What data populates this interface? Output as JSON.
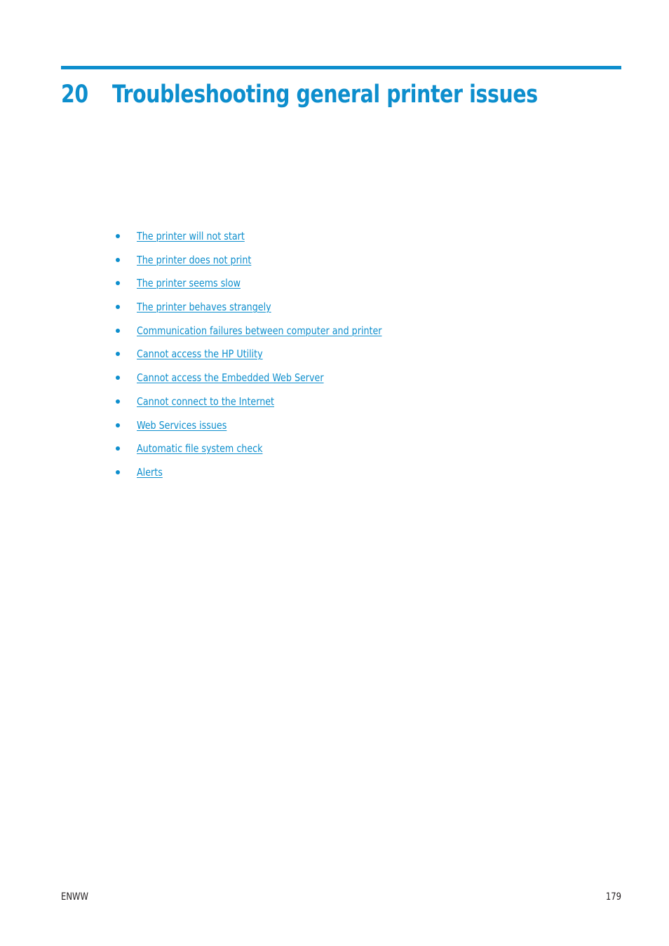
{
  "document": {
    "chapter_number": "20",
    "chapter_title": "Troubleshooting general printer issues",
    "rule_color": "#0d8ecd",
    "accent_color": "#0d8ecd",
    "text_color": "#231f20"
  },
  "toc": {
    "items": [
      {
        "label": "The printer will not start"
      },
      {
        "label": "The printer does not print"
      },
      {
        "label": "The printer seems slow"
      },
      {
        "label": "The printer behaves strangely"
      },
      {
        "label": "Communication failures between computer and printer"
      },
      {
        "label": "Cannot access the HP Utility"
      },
      {
        "label": "Cannot access the Embedded Web Server"
      },
      {
        "label": "Cannot connect to the Internet"
      },
      {
        "label": "Web Services issues"
      },
      {
        "label": "Automatic file system check"
      },
      {
        "label": "Alerts"
      }
    ]
  },
  "footer": {
    "left_label": "ENWW",
    "page_number": "179"
  }
}
